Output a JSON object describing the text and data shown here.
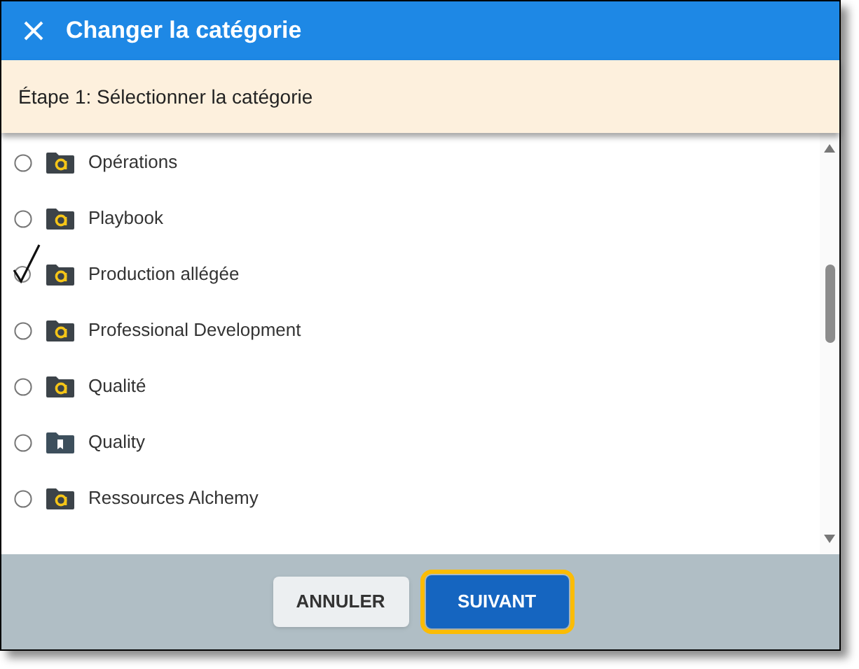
{
  "dialog": {
    "title": "Changer la catégorie",
    "step": "Étape 1: Sélectionner la catégorie"
  },
  "categories": [
    {
      "label": "Opérations",
      "kind": "alchemy",
      "selected": false
    },
    {
      "label": "Playbook",
      "kind": "alchemy",
      "selected": false
    },
    {
      "label": "Production allégée",
      "kind": "alchemy",
      "selected": true
    },
    {
      "label": "Professional Development",
      "kind": "alchemy",
      "selected": false
    },
    {
      "label": "Qualité",
      "kind": "alchemy",
      "selected": false
    },
    {
      "label": "Quality",
      "kind": "bookmark",
      "selected": false
    },
    {
      "label": "Ressources Alchemy",
      "kind": "alchemy",
      "selected": false
    }
  ],
  "buttons": [
    {
      "label": "ANNULER",
      "kind": "secondary"
    },
    {
      "label": "SUIVANT",
      "kind": "primary"
    }
  ]
}
